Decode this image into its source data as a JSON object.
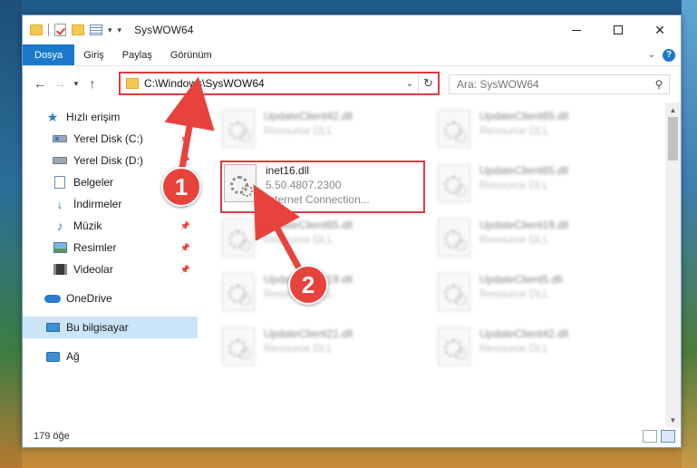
{
  "window": {
    "title": "SysWOW64"
  },
  "quick_access_toolbar": {
    "icons": [
      "folder-icon",
      "properties-check-icon",
      "folder-icon",
      "properties-icon",
      "dropdown-icon"
    ]
  },
  "ribbon": {
    "tabs": [
      "Dosya",
      "Giriş",
      "Paylaş",
      "Görünüm"
    ],
    "active_tab": "Dosya",
    "help": "?"
  },
  "navigation": {
    "address_path": "C:\\Windows\\SysWOW64",
    "search_placeholder": "Ara: SysWOW64"
  },
  "nav_pane": {
    "items": [
      {
        "label": "Hızlı erişim",
        "icon": "star-icon",
        "pinned": false
      },
      {
        "label": "Yerel Disk (C:)",
        "icon": "disk-icon",
        "pinned": true
      },
      {
        "label": "Yerel Disk (D:)",
        "icon": "disk-icon",
        "pinned": true
      },
      {
        "label": "Belgeler",
        "icon": "documents-icon",
        "pinned": true
      },
      {
        "label": "İndirmeler",
        "icon": "download-icon",
        "pinned": true
      },
      {
        "label": "Müzik",
        "icon": "music-icon",
        "pinned": true
      },
      {
        "label": "Resimler",
        "icon": "pictures-icon",
        "pinned": true
      },
      {
        "label": "Videolar",
        "icon": "videos-icon",
        "pinned": true
      },
      {
        "label": "OneDrive",
        "icon": "cloud-icon",
        "pinned": false
      },
      {
        "label": "Bu bilgisayar",
        "icon": "computer-icon",
        "pinned": false,
        "selected": true
      },
      {
        "label": "Ağ",
        "icon": "network-icon",
        "pinned": false
      }
    ]
  },
  "files": {
    "left_column": [
      {
        "name": "UpdateClient42.dll",
        "type": "Resource DLL"
      },
      {
        "name": "inet16.dll",
        "version": "5.50.4807.2300",
        "description": "Internet Connection..."
      },
      {
        "name": "UpdateClient65.dll",
        "type": "Resource DLL"
      },
      {
        "name": "UpdateClient19.dll",
        "type": "Resource DLL"
      },
      {
        "name": "UpdateClient21.dll",
        "type": "Resource DLL"
      }
    ],
    "right_column": [
      {
        "name": "UpdateClient65.dll",
        "type": "Resource DLL"
      },
      {
        "name": "UpdateClient65.dll",
        "type": "Resource DLL"
      },
      {
        "name": "UpdateClient19.dll",
        "type": "Resource DLL"
      },
      {
        "name": "UpdateClient5.dll",
        "type": "Resource DLL"
      },
      {
        "name": "UpdateClient42.dll",
        "type": "Resource DLL"
      }
    ]
  },
  "status_bar": {
    "item_count": "179 öğe"
  },
  "annotations": {
    "step1": "1",
    "step2": "2",
    "highlight_color": "#e0393e"
  }
}
